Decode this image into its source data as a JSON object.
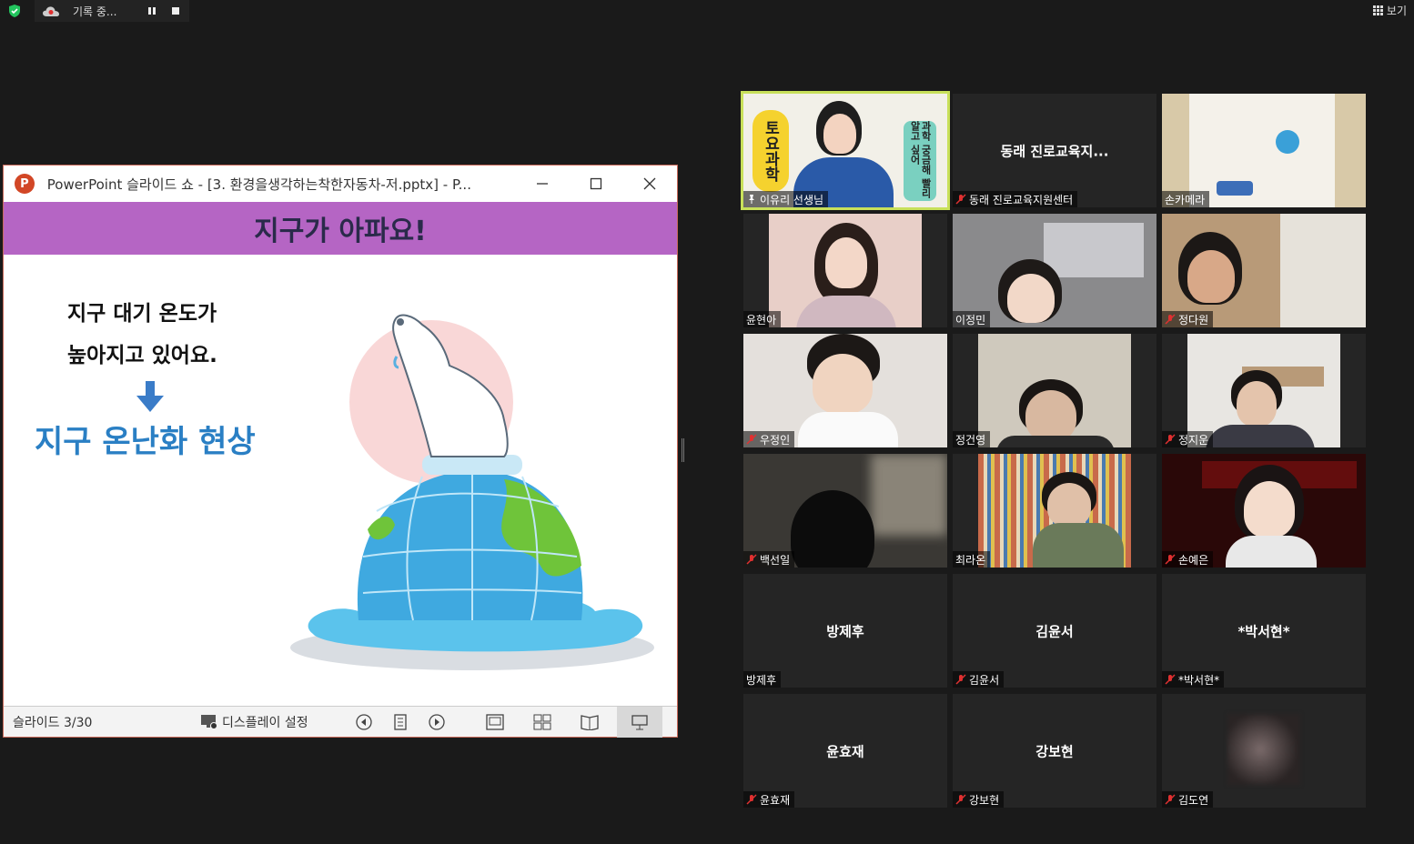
{
  "topbar": {
    "recording_label": "기록 중...",
    "view_label": "보기"
  },
  "ppt": {
    "window_title": "PowerPoint 슬라이드 쇼 - [3. 환경을생각하는착한자동차-저.pptx] - P...",
    "logo_letter": "P",
    "slide": {
      "banner": "지구가 아파요!",
      "line1": "지구 대기 온도가",
      "line2": "높아지고 있어요.",
      "highlight": "지구 온난화 현상"
    },
    "status": {
      "slide_counter": "슬라이드 3/30",
      "display_settings": "디스플레이 설정"
    }
  },
  "participants": [
    {
      "name": "이유리 선생님",
      "muted": false,
      "video": true,
      "active": true
    },
    {
      "name": "동래 진로교육지원센터",
      "display": "동래 진로교육지...",
      "muted": true,
      "video": false
    },
    {
      "name": "손카메라",
      "muted": false,
      "video": true
    },
    {
      "name": "윤현아",
      "muted": false,
      "video": true
    },
    {
      "name": "이정민",
      "muted": false,
      "video": true
    },
    {
      "name": "정다원",
      "muted": true,
      "video": true
    },
    {
      "name": "우정인",
      "muted": true,
      "video": true
    },
    {
      "name": "정건영",
      "muted": false,
      "video": true
    },
    {
      "name": "정지운",
      "muted": true,
      "video": true
    },
    {
      "name": "백선일",
      "muted": true,
      "video": true
    },
    {
      "name": "최라온",
      "muted": false,
      "video": true
    },
    {
      "name": "손예은",
      "muted": true,
      "video": true
    },
    {
      "name": "방제후",
      "display": "방제후",
      "muted": false,
      "video": false
    },
    {
      "name": "김윤서",
      "display": "김윤서",
      "muted": true,
      "video": false
    },
    {
      "name": "*박서현*",
      "display": "*박서현*",
      "muted": true,
      "video": false
    },
    {
      "name": "윤효재",
      "display": "윤효재",
      "muted": true,
      "video": false
    },
    {
      "name": "강보현",
      "display": "강보현",
      "muted": true,
      "video": false
    },
    {
      "name": "김도연",
      "muted": true,
      "video": true
    }
  ],
  "teacher_slide": {
    "side_text": "토요과학",
    "right_text": "과학 궁금해 빨리 알고 싶어"
  },
  "colors": {
    "active_speaker": "#c8e05a",
    "mute_red": "#e03030",
    "ppt_accent": "#d24726",
    "banner": "#b565c4",
    "highlight_text": "#2a7fc4"
  }
}
